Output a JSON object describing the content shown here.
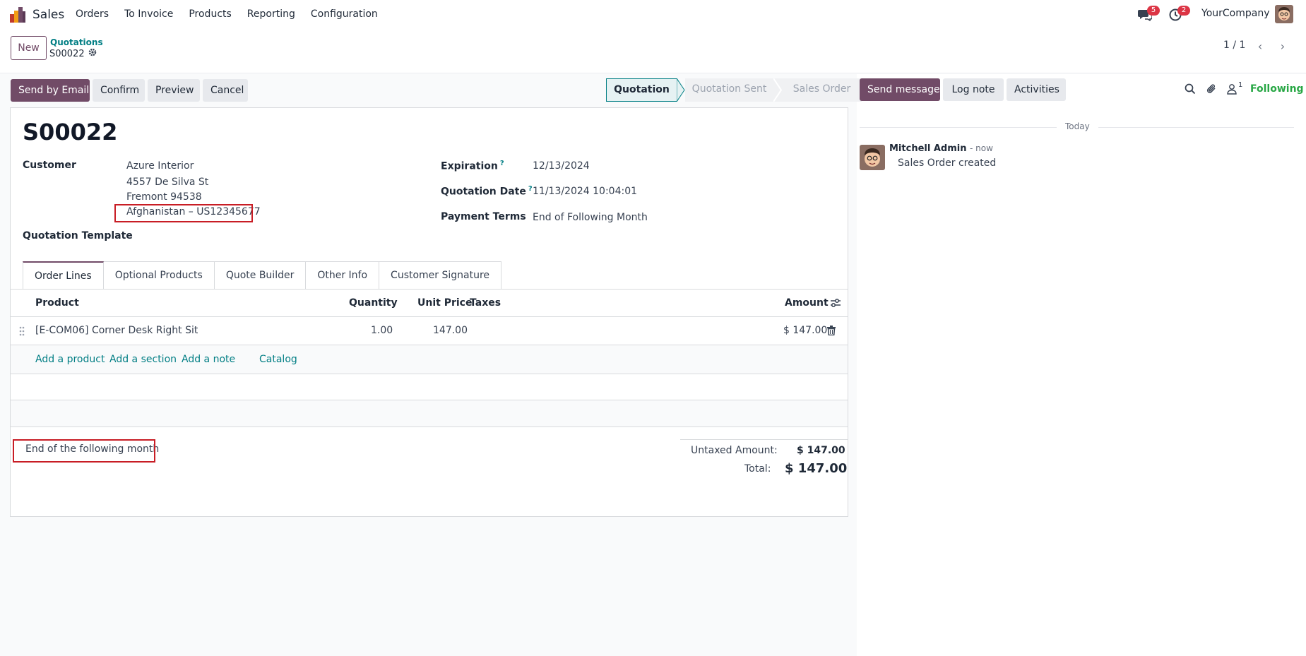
{
  "navbar": {
    "app_name": "Sales",
    "menu": [
      "Orders",
      "To Invoice",
      "Products",
      "Reporting",
      "Configuration"
    ],
    "messages_count": "5",
    "activities_count": "2",
    "company": "YourCompany"
  },
  "control_panel": {
    "new_label": "New",
    "breadcrumb": "Quotations",
    "record_name": "S00022",
    "pager": "1 / 1"
  },
  "actions": {
    "send_by_email": "Send by Email",
    "confirm": "Confirm",
    "preview": "Preview",
    "cancel": "Cancel"
  },
  "statusbar": {
    "stages": [
      "Quotation",
      "Quotation Sent",
      "Sales Order"
    ],
    "active": "Quotation"
  },
  "form": {
    "title": "S00022",
    "customer_label": "Customer",
    "customer_name": "Azure Interior",
    "customer_street": "4557 De Silva St",
    "customer_city": "Fremont 94538",
    "customer_country_vat": "Afghanistan – US12345677",
    "template_label": "Quotation Template",
    "expiration_label": "Expiration",
    "expiration_value": "12/13/2024",
    "quotation_date_label": "Quotation Date",
    "quotation_date_value": "11/13/2024 10:04:01",
    "payment_terms_label": "Payment Terms",
    "payment_terms_value": "End of Following Month",
    "help_mark": "?"
  },
  "tabs": [
    "Order Lines",
    "Optional Products",
    "Quote Builder",
    "Other Info",
    "Customer Signature"
  ],
  "order_lines": {
    "headers": {
      "product": "Product",
      "quantity": "Quantity",
      "unit_price": "Unit Price",
      "taxes": "Taxes",
      "amount": "Amount"
    },
    "rows": [
      {
        "product": "[E-COM06] Corner Desk Right Sit",
        "quantity": "1.00",
        "unit_price": "147.00",
        "taxes": "",
        "amount": "$ 147.00"
      }
    ],
    "add_product": "Add a product",
    "add_section": "Add a section",
    "add_note": "Add a note",
    "catalog": "Catalog"
  },
  "note": "End of the following month",
  "totals": {
    "untaxed_label": "Untaxed Amount:",
    "untaxed_value": "$ 147.00",
    "total_label": "Total:",
    "total_value": "$ 147.00"
  },
  "chatter": {
    "send_message": "Send message",
    "log_note": "Log note",
    "activities": "Activities",
    "followers_count": "1",
    "following": "Following",
    "date_separator": "Today",
    "message": {
      "author": "Mitchell Admin",
      "time": "- now",
      "body": "Sales Order created"
    }
  },
  "colors": {
    "brand": "#714b67",
    "link": "#017e84",
    "highlight": "#c81d25",
    "following": "#28a745",
    "badge": "#dc3545"
  }
}
